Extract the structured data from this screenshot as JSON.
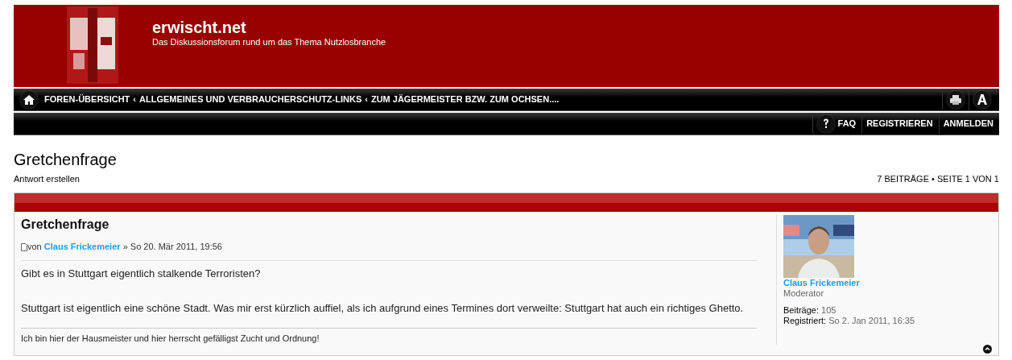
{
  "site": {
    "title": "erwischt.net",
    "tagline": "Das Diskussionsforum rund um das Thema Nutzlosbranche"
  },
  "breadcrumbs": [
    {
      "label": "FOREN-ÜBERSICHT"
    },
    {
      "label": "ALLGEMEINES UND VERBRAUCHERSCHUTZ-LINKS"
    },
    {
      "label": "ZUM JÄGERMEISTER BZW. ZUM OCHSEN...."
    }
  ],
  "breadcrumb_separator": "‹",
  "user_links": [
    {
      "label": "FAQ",
      "kind": "help"
    },
    {
      "label": "REGISTRIEREN",
      "kind": "plain"
    },
    {
      "label": "ANMELDEN",
      "kind": "plain"
    }
  ],
  "topic": {
    "title": "Gretchenfrage",
    "reply_link": "Antwort erstellen",
    "pagination": "7 BEITRÄGE • SEITE 1 VON 1"
  },
  "posts": [
    {
      "title": "Gretchenfrage",
      "by": "von",
      "author": "Claus Frickemeier",
      "separator": "»",
      "date": "So 20. Mär 2011, 19:56",
      "paragraphs": [
        "Gibt es in Stuttgart eigentlich stalkende Terroristen?",
        "Stuttgart ist eigentlich eine schöne Stadt. Was mir erst kürzlich auffiel, als ich aufgrund eines Termines dort verweilte: Stuttgart hat auch ein richtiges Ghetto."
      ],
      "signature": "Ich bin hier der Hausmeister und hier herrscht gefälligst Zucht und Ordnung!",
      "profile": {
        "name": "Claus Frickemeier",
        "rank": "Moderator",
        "stats": [
          {
            "label": "Beiträge:",
            "value": "105"
          },
          {
            "label": "Registriert:",
            "value": "So 2. Jan 2011, 16:35"
          }
        ]
      }
    }
  ]
}
